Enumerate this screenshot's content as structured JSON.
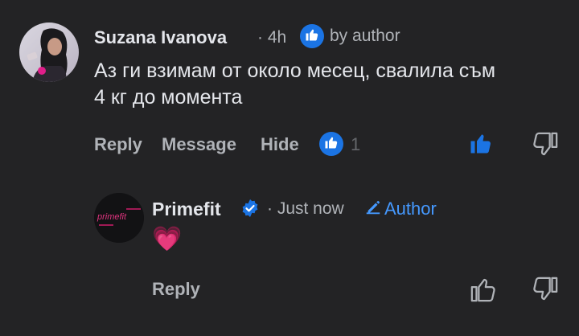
{
  "comment": {
    "author_name": "Suzana Ivanova",
    "time": "· 4h",
    "liked_by": "by author",
    "text_line1": "Аз ги взимам от около месец, свалила съм",
    "text_line2": "4 кг до момента",
    "actions": {
      "reply": "Reply",
      "message": "Message",
      "hide": "Hide"
    },
    "like_count": "1"
  },
  "reply": {
    "author_name": "Primefit",
    "time": "· Just now",
    "author_badge": "Author",
    "text": "💗",
    "reply_label": "Reply",
    "logo_text": "primefit"
  },
  "colors": {
    "background": "#232325",
    "like_blue": "#1b74e4",
    "author_blue": "#4599ff",
    "text_secondary": "#b0b3b8"
  }
}
